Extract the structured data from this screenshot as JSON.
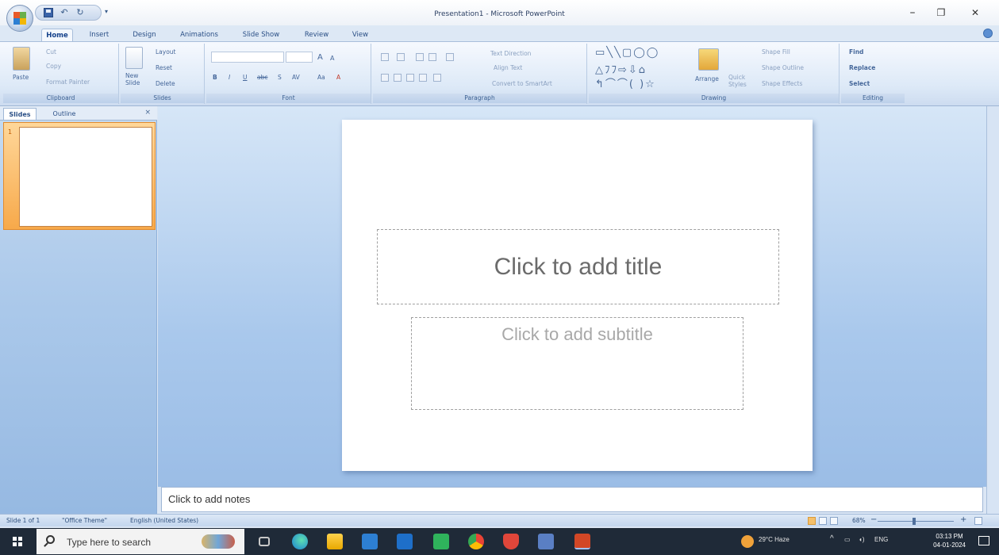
{
  "window": {
    "title": "Presentation1 - Microsoft PowerPoint",
    "controls": {
      "minimize": "–",
      "maximize": "❐",
      "close": "✕"
    }
  },
  "quick_access": {
    "undo": "↶",
    "redo": "↻",
    "more": "▾"
  },
  "tabs": [
    "Home",
    "Insert",
    "Design",
    "Animations",
    "Slide Show",
    "Review",
    "View"
  ],
  "ribbon": {
    "clipboard": {
      "label": "Clipboard",
      "paste": "Paste",
      "cut": "Cut",
      "copy": "Copy",
      "format_painter": "Format Painter"
    },
    "slides": {
      "label": "Slides",
      "new_slide": "New Slide",
      "layout": "Layout",
      "reset": "Reset",
      "delete": "Delete"
    },
    "font": {
      "label": "Font",
      "bold": "B",
      "italic": "I",
      "underline": "U",
      "strike": "abc",
      "shadow": "S",
      "spacing": "AV",
      "case": "Aa",
      "color": "A",
      "grow": "A",
      "shrink": "A"
    },
    "paragraph": {
      "label": "Paragraph",
      "text_direction": "Text Direction",
      "align_text": "Align Text",
      "smartart": "Convert to SmartArt"
    },
    "drawing": {
      "label": "Drawing",
      "arrange": "Arrange",
      "quick_styles": "Quick Styles",
      "shape_fill": "Shape Fill",
      "shape_outline": "Shape Outline",
      "shape_effects": "Shape Effects"
    },
    "editing": {
      "label": "Editing",
      "find": "Find",
      "replace": "Replace",
      "select": "Select"
    }
  },
  "slides_pane": {
    "tabs": [
      "Slides",
      "Outline"
    ],
    "close": "×",
    "thumbnail_number": "1"
  },
  "slide": {
    "title_placeholder": "Click to add title",
    "subtitle_placeholder": "Click to add subtitle"
  },
  "notes": {
    "placeholder": "Click to add notes"
  },
  "status": {
    "slide": "Slide 1 of 1",
    "theme": "\"Office Theme\"",
    "language": "English (United States)",
    "zoom": "68%",
    "zoom_minus": "−",
    "zoom_plus": "+"
  },
  "taskbar": {
    "search_placeholder": "Type here to search",
    "weather": "29°C  Haze",
    "language": "ENG",
    "time": "03:13 PM",
    "date": "04-01-2024"
  }
}
